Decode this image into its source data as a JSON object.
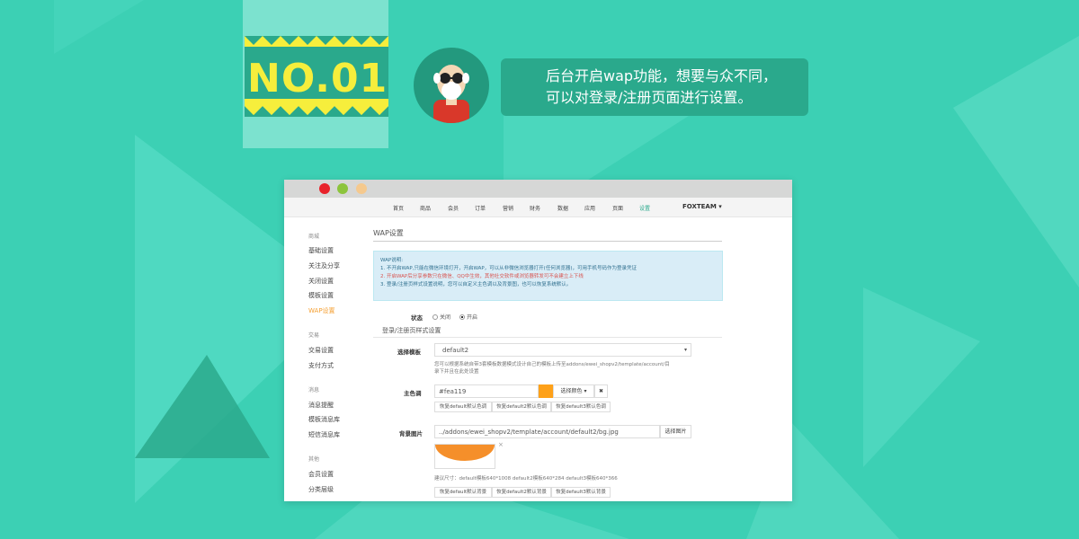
{
  "banner": {
    "number": "NO.01"
  },
  "speech": {
    "line1": "后台开启wap功能，想要与众不同，",
    "line2": "可以对登录/注册页面进行设置。"
  },
  "colors": {
    "background": "#3cd0b4",
    "accent": "#2aa98c",
    "banner_yellow": "#f6ee3c",
    "active_orange": "#f5a033",
    "main_color": "#fea119"
  },
  "window": {
    "traffic_lights": [
      "#e8222a",
      "#8cc43c",
      "#f5c98e"
    ],
    "nav": {
      "items": [
        "首页",
        "商品",
        "会员",
        "订单",
        "营销",
        "财务",
        "数据",
        "应用",
        "页面",
        "设置"
      ],
      "active": "设置",
      "brand": "FOXTEAM ▾"
    },
    "sidebar": {
      "groups": [
        {
          "title": "商城",
          "items": [
            "基础设置",
            "关注及分享",
            "关闭设置",
            "模板设置",
            "WAP设置"
          ]
        },
        {
          "title": "交易",
          "items": [
            "交易设置",
            "支付方式"
          ]
        },
        {
          "title": "消息",
          "items": [
            "消息提醒",
            "模板消息库",
            "短信消息库"
          ]
        },
        {
          "title": "其他",
          "items": [
            "会员设置",
            "分类层级"
          ]
        }
      ],
      "active": "WAP设置"
    },
    "content": {
      "page_title": "WAP设置",
      "info": {
        "heading": "WAP说明:",
        "line1": "1. 不开启WAP,只能在微信环境打开，开启WAP，可以从非微信浏览器打开(任何浏览器)，可用手机号码作为登录凭证",
        "line2": "2. 开启WAP后分享参数只在微信、QQ中生效，其他社交软件或浏览器转发可不会建立上下线",
        "line3": "3. 登录/注册页样式设置说明，您可以自定义主色调以及背景图，也可以恢复系统默认。"
      },
      "status": {
        "label": "状态",
        "options": [
          "关闭",
          "开启"
        ],
        "selected": "开启"
      },
      "section_title": "登录/注册页样式设置",
      "template": {
        "label": "选择模板",
        "value": "default2",
        "hint_line1": "您可以根据系统自带3套模板数据模式设计自己的模板上传至addons/ewei_shopv2/template/account/目",
        "hint_line2": "录下并且在此处设置"
      },
      "main_color": {
        "label": "主色调",
        "value": "#fea119",
        "pick_button": "选择颜色 ▾",
        "clear_button": "✖",
        "reset_buttons": [
          "恢复default默认色调",
          "恢复default2默认色调",
          "恢复default3默认色调"
        ]
      },
      "background": {
        "label": "背景图片",
        "value": "../addons/ewei_shopv2/template/account/default2/bg.jpg",
        "choose_button": "选择图片",
        "remove_icon": "×",
        "size_hint": "建议尺寸：default模板640*1008 default2模板640*284 default3模板640*366",
        "reset_buttons": [
          "恢复default默认背景",
          "恢复default2默认背景",
          "恢复default3默认背景"
        ]
      }
    }
  }
}
